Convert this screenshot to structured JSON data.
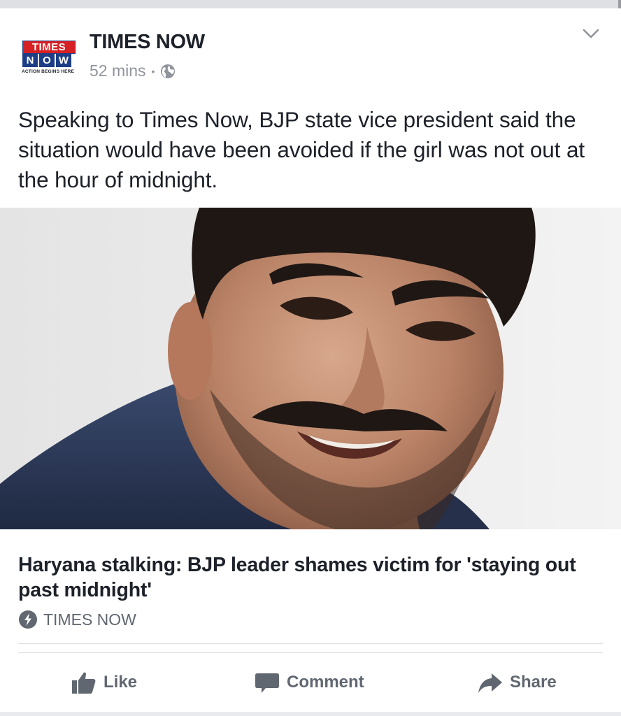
{
  "post": {
    "page_name": "TIMES NOW",
    "timestamp": "52 mins",
    "separator": "•",
    "privacy_icon": "globe-icon",
    "text": "Speaking to Times Now, BJP state vice president said the situation would have been avoided if the girl was not out at the hour of midnight."
  },
  "logo": {
    "line1": "TIMES",
    "line2": [
      "N",
      "O",
      "W"
    ],
    "tagline": "ACTION BEGINS HERE",
    "colors": {
      "red": "#d72024",
      "blue": "#1d3e86"
    }
  },
  "link_preview": {
    "headline": "Haryana stalking: BJP leader shames victim for 'staying out past midnight'",
    "source": "TIMES NOW",
    "source_icon": "instant-article-bolt-icon"
  },
  "actions": {
    "like": "Like",
    "comment": "Comment",
    "share": "Share"
  },
  "colors": {
    "text": "#1d2129",
    "meta": "#90949c",
    "action": "#606770",
    "divider": "#dadde1"
  }
}
